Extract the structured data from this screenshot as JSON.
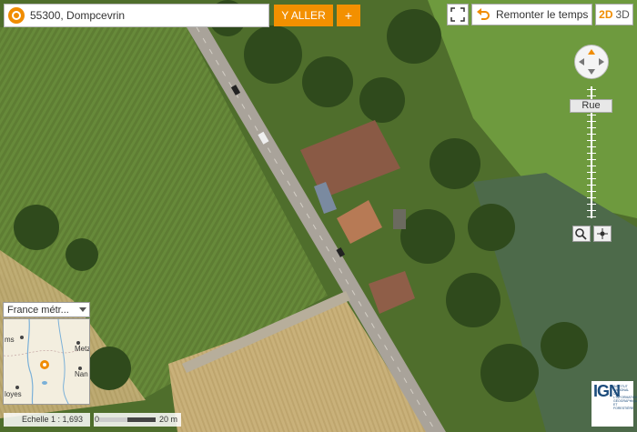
{
  "search": {
    "value": "55300, Dompcevrin",
    "go_label": "Y ALLER",
    "plus_label": "+"
  },
  "toolbar": {
    "time_label": "Remonter le temps",
    "mode_2d": "2D",
    "mode_3d": "3D"
  },
  "zoom": {
    "level_label": "Rue"
  },
  "minimap": {
    "selector_value": "France métr...",
    "places": [
      "ms",
      "Metz",
      "Nan",
      "loyes"
    ]
  },
  "scale": {
    "ratio_label": "Echelle 1 : 1,693",
    "zero_label": "0",
    "distance_label": "20 m"
  },
  "logo": {
    "letters": "IGN",
    "tagline": "INSTITUT NATIONAL DE L'INFORMATION GÉOGRAPHIQUE ET FORESTIÈRE"
  },
  "colors": {
    "accent": "#f39000",
    "field_green": "#6f8a3c",
    "crop_tan": "#c8b078",
    "road": "#a9a39a",
    "roof": "#8a5a45"
  }
}
